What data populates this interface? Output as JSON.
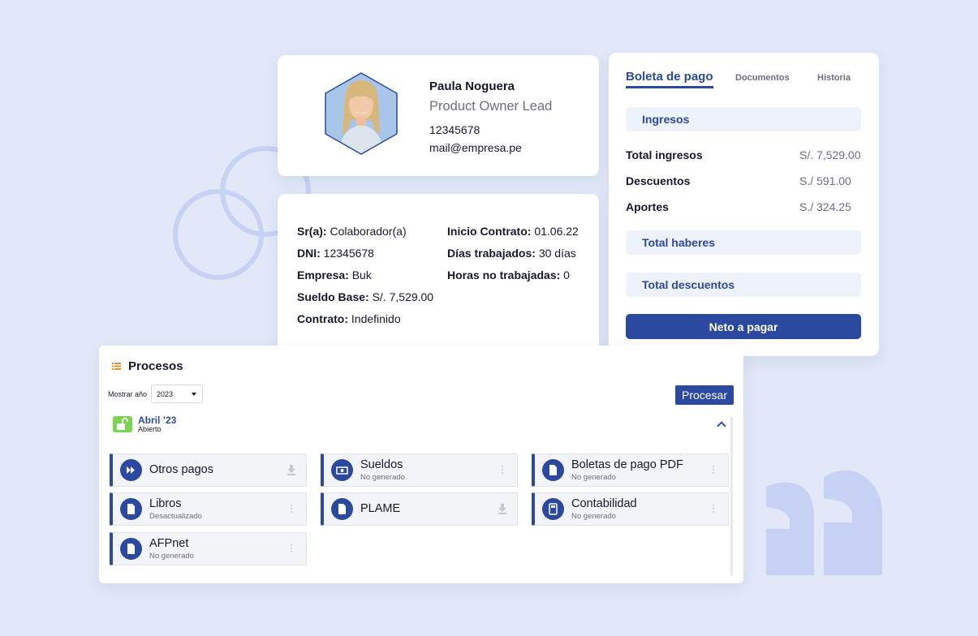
{
  "profile": {
    "name": "Paula Noguera",
    "role": "Product Owner Lead",
    "id": "12345678",
    "email": "mail@empresa.pe"
  },
  "details": {
    "left": [
      {
        "label": "Sr(a):",
        "value": "Colaborador(a)"
      },
      {
        "label": "DNI:",
        "value": "12345678"
      },
      {
        "label": "Empresa:",
        "value": "Buk"
      },
      {
        "label": "Sueldo Base:",
        "value": "S/. 7,529.00"
      },
      {
        "label": "Contrato:",
        "value": "Indefinido"
      }
    ],
    "right": [
      {
        "label": "Inicio Contrato:",
        "value": "01.06.22"
      },
      {
        "label": "Días trabajados:",
        "value": "30 días"
      },
      {
        "label": "Horas no trabajadas:",
        "value": "0"
      }
    ]
  },
  "boleta": {
    "tabs": [
      "Boleta de pago",
      "Documentos",
      "Historia"
    ],
    "ingresos_label": "Ingresos",
    "rows": [
      {
        "label": "Total ingresos",
        "value": "S/. 7,529.00"
      },
      {
        "label": "Descuentos",
        "value": "S./ 591.00"
      },
      {
        "label": "Aportes",
        "value": "S./ 324.25"
      }
    ],
    "total_haberes": "Total haberes",
    "total_descuentos": "Total descuentos",
    "neto": "Neto a pagar"
  },
  "procesos": {
    "title": "Procesos",
    "year_label": "Mostrar año",
    "year_value": "2023",
    "procesar": "Procesar",
    "period_title": "Abril ’23",
    "period_status": "Abierto",
    "items": [
      {
        "name": "Otros pagos",
        "status": "",
        "icon": "fast-forward-icon",
        "action": "download-icon"
      },
      {
        "name": "Sueldos",
        "status": "No generado",
        "icon": "money-icon",
        "action": "more-icon"
      },
      {
        "name": "Boletas de pago PDF",
        "status": "No generado",
        "icon": "document-icon",
        "action": "more-icon"
      },
      {
        "name": "Libros",
        "status": "Desactualizado",
        "icon": "document-icon",
        "action": "more-icon"
      },
      {
        "name": "PLAME",
        "status": "",
        "icon": "document-icon",
        "action": "download-icon"
      },
      {
        "name": "Contabilidad",
        "status": "No generado",
        "icon": "calculator-icon",
        "action": "more-icon"
      },
      {
        "name": "AFPnet",
        "status": "No generado",
        "icon": "document-icon",
        "action": "more-icon"
      }
    ]
  },
  "colors": {
    "accent": "#2c49a0",
    "background": "#e2e8f8",
    "lock_green": "#7bd44f"
  }
}
